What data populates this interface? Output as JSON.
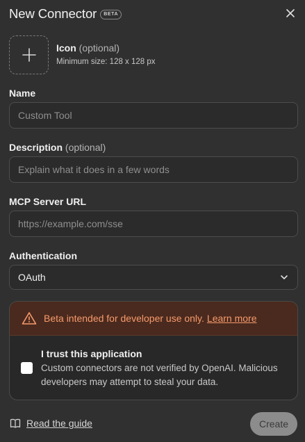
{
  "header": {
    "title": "New Connector",
    "badge": "BETA"
  },
  "icon_section": {
    "label": "Icon",
    "label_suffix": " (optional)",
    "hint": "Minimum size: 128 x 128 px"
  },
  "fields": {
    "name": {
      "label": "Name",
      "placeholder": "Custom Tool",
      "value": ""
    },
    "description": {
      "label": "Description",
      "label_suffix": " (optional)",
      "placeholder": "Explain what it does in a few words",
      "value": ""
    },
    "mcp_url": {
      "label": "MCP Server URL",
      "placeholder": "https://example.com/sse",
      "value": ""
    },
    "authentication": {
      "label": "Authentication",
      "selected": "OAuth"
    }
  },
  "warning": {
    "text": "Beta intended for developer use only.",
    "link": "Learn more",
    "color": "#f79a6c"
  },
  "trust": {
    "title": "I trust this application",
    "description": "Custom connectors are not verified by OpenAI. Malicious developers may attempt to steal your data.",
    "checked": false
  },
  "footer": {
    "guide_label": "Read the guide",
    "create_label": "Create"
  }
}
